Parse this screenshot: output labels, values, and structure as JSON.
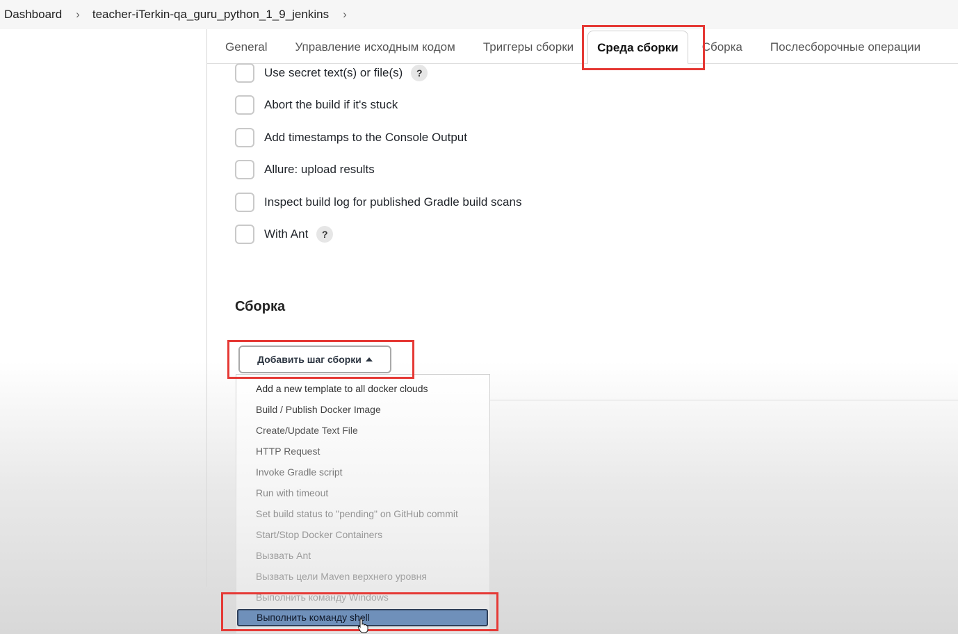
{
  "breadcrumb": {
    "items": [
      "Dashboard",
      "teacher-iTerkin-qa_guru_python_1_9_jenkins"
    ]
  },
  "tabs": [
    {
      "label": "General"
    },
    {
      "label": "Управление исходным кодом"
    },
    {
      "label": "Триггеры сборки"
    },
    {
      "label": "Среда сборки",
      "active": true
    },
    {
      "label": "Сборка"
    },
    {
      "label": "Послесборочные операции"
    }
  ],
  "build_env": {
    "options": [
      {
        "label": "Use secret text(s) or file(s)",
        "checked": false,
        "help": true
      },
      {
        "label": "Abort the build if it's stuck",
        "checked": false
      },
      {
        "label": "Add timestamps to the Console Output",
        "checked": false
      },
      {
        "label": "Allure: upload results",
        "checked": false
      },
      {
        "label": "Inspect build log for published Gradle build scans",
        "checked": false
      },
      {
        "label": "With Ant",
        "checked": false,
        "help": true
      }
    ],
    "help_symbol": "?"
  },
  "build": {
    "title": "Сборка",
    "add_step_label": "Добавить шаг сборки",
    "menu": [
      "Add a new template to all docker clouds",
      "Build / Publish Docker Image",
      "Create/Update Text File",
      "HTTP Request",
      "Invoke Gradle script",
      "Run with timeout",
      "Set build status to \"pending\" on GitHub commit",
      "Start/Stop Docker Containers",
      "Вызвать Ant",
      "Вызвать цели Maven верхнего уровня",
      "Выполнить команду Windows"
    ],
    "selected_item": "Выполнить команду shell"
  },
  "colors": {
    "highlight": "#e53935",
    "selected_bg": "#6f90ba"
  }
}
